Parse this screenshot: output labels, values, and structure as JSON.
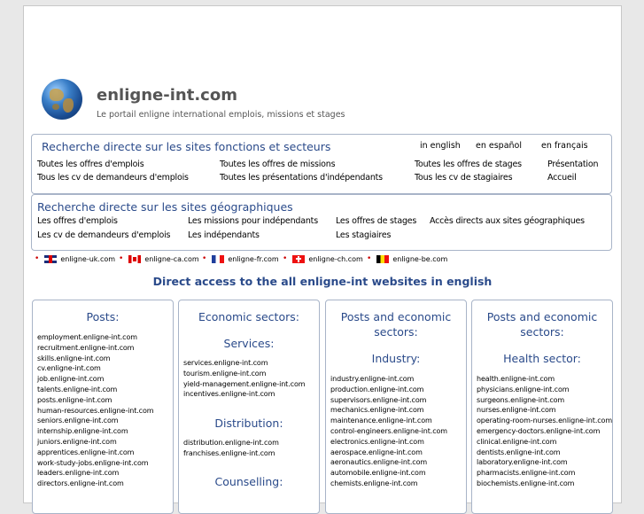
{
  "header": {
    "title": "enligne-int.com",
    "subtitle": "Le portail enligne international emplois, missions et stages"
  },
  "functions_panel": {
    "title": "Recherche directe sur les sites fonctions et secteurs",
    "languages": [
      "in english",
      "en español",
      "en français"
    ],
    "links_row1": [
      "Toutes les offres d'emplois",
      "Toutes les offres de missions",
      "Toutes les offres de stages",
      "Présentation"
    ],
    "links_row2": [
      "Tous les cv de demandeurs d'emplois",
      "Toutes les présentations d'indépendants",
      "Tous les cv de stagiaires",
      "Accueil"
    ]
  },
  "geo_panel": {
    "title": "Recherche directe sur les sites géographiques",
    "links_row1": [
      "Les offres d'emplois",
      "Les missions pour indépendants",
      "Les offres de stages",
      "Accès directs aux sites géographiques"
    ],
    "links_row2": [
      "Les cv de demandeurs d'emplois",
      "Les indépendants",
      "Les stagiaires"
    ]
  },
  "countries": [
    {
      "flag": "uk-flag-icon",
      "label": "enligne-uk.com"
    },
    {
      "flag": "canada-flag-icon",
      "label": "enligne-ca.com"
    },
    {
      "flag": "france-flag-icon",
      "label": "enligne-fr.com"
    },
    {
      "flag": "switzerland-flag-icon",
      "label": "enligne-ch.com"
    },
    {
      "flag": "belgium-flag-icon",
      "label": "enligne-be.com"
    }
  ],
  "direct_title": "Direct access to the all enligne-int websites in english",
  "columns": {
    "posts": {
      "heading": "Posts:",
      "links": [
        "employment.enligne-int.com",
        "recruitment.enligne-int.com",
        "skills.enligne-int.com",
        "cv.enligne-int.com",
        "job.enligne-int.com",
        "talents.enligne-int.com",
        "posts.enligne-int.com",
        "human-resources.enligne-int.com",
        "seniors.enligne-int.com",
        "internship.enligne-int.com",
        "juniors.enligne-int.com",
        "apprentices.enligne-int.com",
        "work-study-jobs.enligne-int.com",
        "leaders.enligne-int.com",
        "directors.enligne-int.com"
      ]
    },
    "economic": {
      "heading": "Economic sectors:",
      "services_heading": "Services:",
      "services_links": [
        "services.enligne-int.com",
        "tourism.enligne-int.com",
        "yield-management.enligne-int.com",
        "incentives.enligne-int.com"
      ],
      "distribution_heading": "Distribution:",
      "distribution_links": [
        "distribution.enligne-int.com",
        "franchises.enligne-int.com"
      ],
      "counselling_heading": "Counselling:"
    },
    "industry": {
      "heading_line1": "Posts and economic",
      "heading_line2": "sectors:",
      "sub_heading": "Industry:",
      "links": [
        "industry.enligne-int.com",
        "production.enligne-int.com",
        "supervisors.enligne-int.com",
        "mechanics.enligne-int.com",
        "maintenance.enligne-int.com",
        "control-engineers.enligne-int.com",
        "electronics.enligne-int.com",
        "aerospace.enligne-int.com",
        "aeronautics.enligne-int.com",
        "automobile.enligne-int.com",
        "chemists.enligne-int.com"
      ]
    },
    "health": {
      "heading_line1": "Posts and economic",
      "heading_line2": "sectors:",
      "sub_heading": "Health sector:",
      "links": [
        "health.enligne-int.com",
        "physicians.enligne-int.com",
        "surgeons.enligne-int.com",
        "nurses.enligne-int.com",
        "operating-room-nurses.enligne-int.com",
        "emergency-doctors.enligne-int.com",
        "clinical.enligne-int.com",
        "dentists.enligne-int.com",
        "laboratory.enligne-int.com",
        "pharmacists.enligne-int.com",
        "biochemists.enligne-int.com"
      ]
    }
  }
}
